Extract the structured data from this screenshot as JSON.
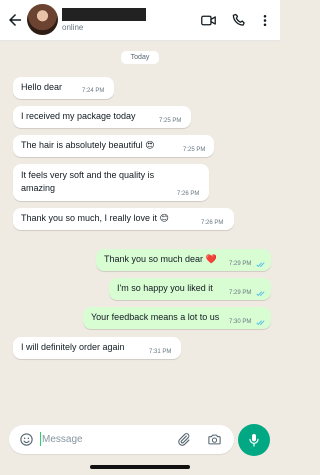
{
  "header": {
    "status": "online"
  },
  "date_label": "Today",
  "messages": [
    {
      "text": "Hello dear",
      "time": "7:24 PM",
      "dir": "in"
    },
    {
      "text": "I received my package today",
      "time": "7:25 PM",
      "dir": "in"
    },
    {
      "text": "The hair is absolutely beautiful 😍",
      "time": "7:25 PM",
      "dir": "in"
    },
    {
      "text": "It feels very soft and the quality is amazing",
      "time": "7:26 PM",
      "dir": "in"
    },
    {
      "text": "Thank you so much, I really love it 😊",
      "time": "7:26 PM",
      "dir": "in"
    },
    {
      "text": "Thank you so much dear ❤️",
      "time": "7:29 PM",
      "dir": "out"
    },
    {
      "text": "I'm so happy you liked it",
      "time": "7:29 PM",
      "dir": "out"
    },
    {
      "text": "Your feedback means a lot to us",
      "time": "7:30 PM",
      "dir": "out"
    },
    {
      "text": "I will definitely order again",
      "time": "7:31 PM",
      "dir": "in"
    }
  ],
  "composer": {
    "placeholder": "Message"
  },
  "colors": {
    "chat_bg": "#efeae2",
    "incoming": "#ffffff",
    "outgoing": "#d9fdd3",
    "accent": "#00a884",
    "read_ticks": "#53bdeb"
  },
  "icons": [
    "back-arrow-icon",
    "video-call-icon",
    "phone-icon",
    "more-vertical-icon",
    "emoji-icon",
    "attach-icon",
    "camera-icon",
    "mic-icon"
  ]
}
